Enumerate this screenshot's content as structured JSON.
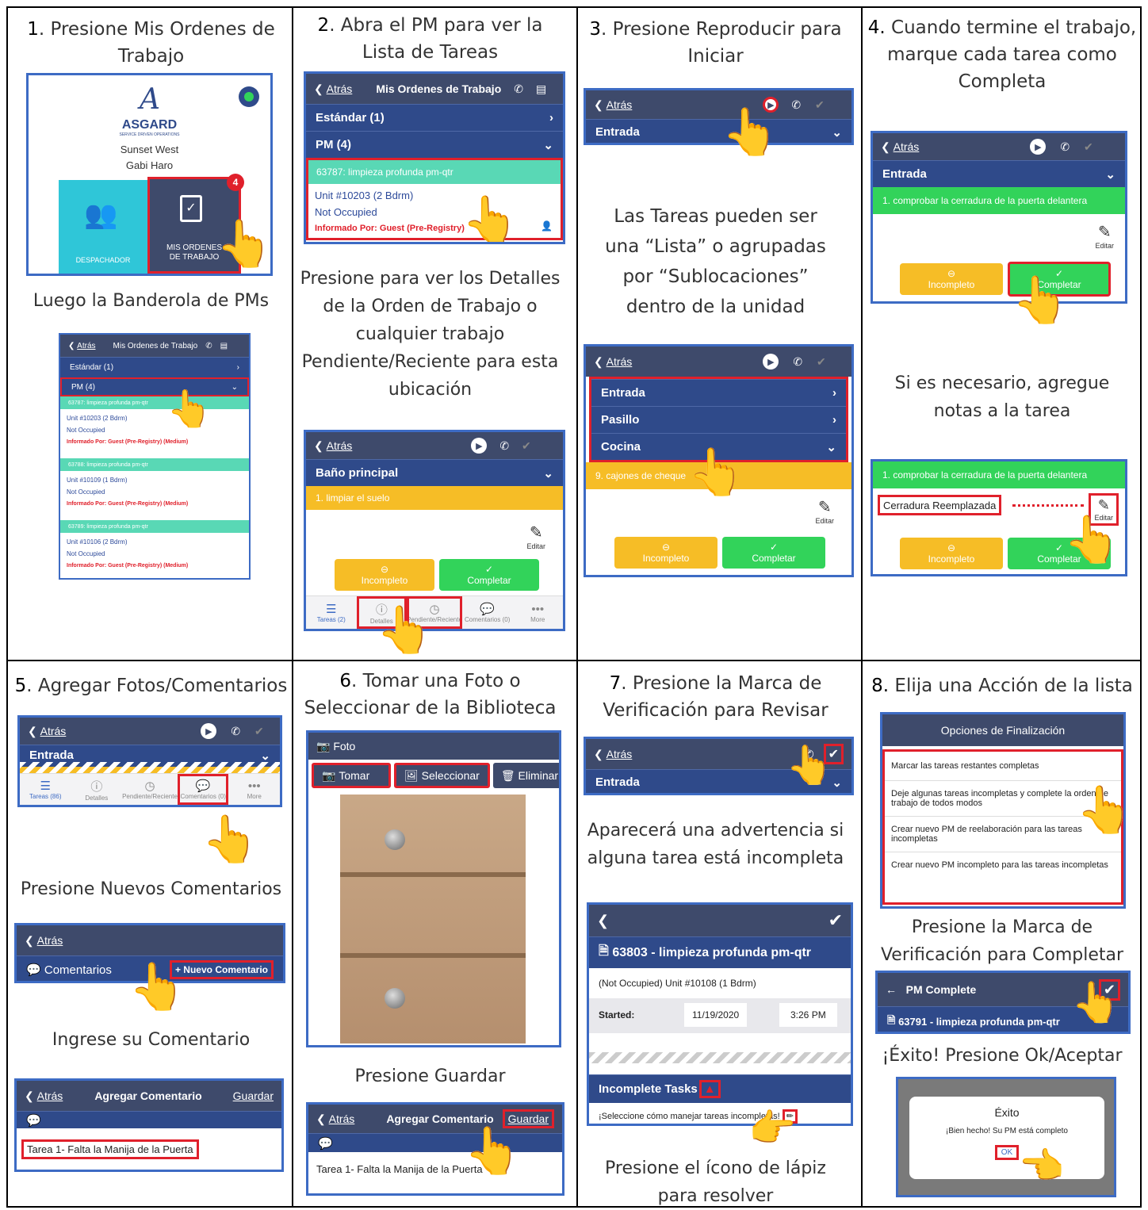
{
  "steps": {
    "s1_num": "1",
    "s1_text": ". Presione Mis Ordenes de",
    "s1_text2": "Trabajo",
    "s2_num": "2",
    "s2_text": ". Abra el PM para ver la",
    "s2_text2": "Lista de Tareas",
    "s3_num": "3",
    "s3_text": ". Presione Reproducir para",
    "s3_text2": "Iniciar",
    "s4_num": "4.",
    "s4_text": " Cuando termine el trabajo,",
    "s4_text2": "marque cada tarea como",
    "s4_text3": "Completa",
    "s5_num": "5",
    "s5_text": ". Agregar Fotos/Comentarios",
    "s6_num": "6",
    "s6_text": ". Tomar una Foto o",
    "s6_text2": "Seleccionar de la Biblioteca",
    "s7_num": "7",
    "s7_text": ". Presione la Marca de",
    "s7_text2": "Verificación para Revisar",
    "s8_num": "8.",
    "s8_text": " Elija una Acción de la lista"
  },
  "captions": {
    "c1": "Luego la Banderola de PMs",
    "c2a": "Presione para ver los Detalles",
    "c2b": "de la Orden de Trabajo o",
    "c2c": "cualquier trabajo",
    "c2d": "Pendiente/Reciente para esta",
    "c2e": "ubicación",
    "c3a": "Las Tareas pueden ser",
    "c3b": "una “Lista” o agrupadas",
    "c3c": "por “Sublocaciones”",
    "c3d": "dentro de la unidad",
    "c4a": "Si es necesario, agregue",
    "c4b": "notas a la tarea",
    "c5a": "Presione Nuevos Comentarios",
    "c5b": "Ingrese su Comentario",
    "c6": "Presione Guardar",
    "c7a": "Aparecerá una advertencia si",
    "c7b": "alguna tarea está incompleta",
    "c7c": "Presione el ícono de lápiz",
    "c7d": "para resolver",
    "c8a": "Presione la Marca de",
    "c8b": "Verificación para Completar",
    "c8c": "¡Éxito! Presione Ok/Aceptar"
  },
  "ui": {
    "back": "Atrás",
    "my_orders": "Mis Ordenes de Trabajo",
    "standard": "Estándar (1)",
    "pm4": "PM (4)",
    "asgard": "ASGARD",
    "asgard_sub": "SERVICE DRIVEN OPERATIONS",
    "sunset": "Sunset West",
    "gabi": "Gabi Haro",
    "badge": "4",
    "dispatcher": "DESPACHADOR",
    "mis_ordenes_tile1": "MIS ORDENES",
    "mis_ordenes_tile2": "DE TRABAJO",
    "wo1": "63787: limpieza profunda pm-qtr",
    "unit1": "Unit #10203 (2 Bdrm)",
    "wo2": "63788: limpieza profunda pm-qtr",
    "unit2": "Unit #10109 (1 Bdrm)",
    "wo3": "63789: limpieza profunda pm-qtr",
    "unit3": "Unit #10106 (2 Bdrm)",
    "not_occupied": "Not Occupied",
    "informado": "Informado Por: Guest (Pre-Registry) (Medium)",
    "informado_short": "Informado Por: Guest (Pre-Registry)",
    "entrada": "Entrada",
    "pasillo": "Pasillo",
    "cocina": "Cocina",
    "cajones": "9. cajones de cheque",
    "bano": "Baño principal",
    "limpiar": "1. limpiar el suelo",
    "editar": "Editar",
    "incompleto": "Incompleto",
    "completar": "Completar",
    "tab_tareas2": "Tareas (2)",
    "tab_detalles": "Detalles",
    "tab_pend": "Pendiente/Reciente",
    "tab_coment": "Comentarios (0)",
    "tab_more": "More",
    "tab_tareas86": "Tareas (86)",
    "cerradura_task": "1. comprobar la cerradura de la puerta delantera",
    "cerradura_note": "Cerradura Reemplazada",
    "comentarios": "Comentarios",
    "nuevo_comentario": "+ Nuevo Comentario",
    "agregar_comentario": "Agregar Comentario",
    "guardar": "Guardar",
    "comment_text": "Tarea 1- Falta la Manija de la Puerta",
    "foto": "Foto",
    "tomar": "Tomar",
    "seleccionar": "Seleccionar",
    "eliminar": "Eliminar",
    "wo_title": "63803 - limpieza profunda pm-qtr",
    "unit_line": "(Not Occupied)  Unit #10108 (1 Bdrm)",
    "started": "Started:",
    "started_date": "11/19/2020",
    "started_time": "3:26 PM",
    "incomplete_tasks": "Incomplete Tasks",
    "select_how": "¡Seleccione cómo manejar tareas incompletas!",
    "opciones": "Opciones de Finalización",
    "opt1": "Marcar las tareas restantes completas",
    "opt2": "Deje algunas tareas incompletas y complete la orden de trabajo de todos modos",
    "opt3": "Crear nuevo PM de reelaboración para las tareas incompletas",
    "opt4": "Crear nuevo PM incompleto para las tareas incompletas",
    "pm_complete": "PM Complete",
    "wo_final": "63791 - limpieza profunda pm-qtr",
    "exito": "Éxito",
    "bien_hecho": "¡Bien hecho! Su PM está completo",
    "ok": "OK"
  },
  "colors": {
    "nav": "#3e4a6b",
    "section": "#2f4a8a",
    "green": "#32d35a",
    "yellow": "#f6bd26",
    "teal": "#59d8b5",
    "red_outline": "#e0202b",
    "frame": "#3d6bc4"
  }
}
